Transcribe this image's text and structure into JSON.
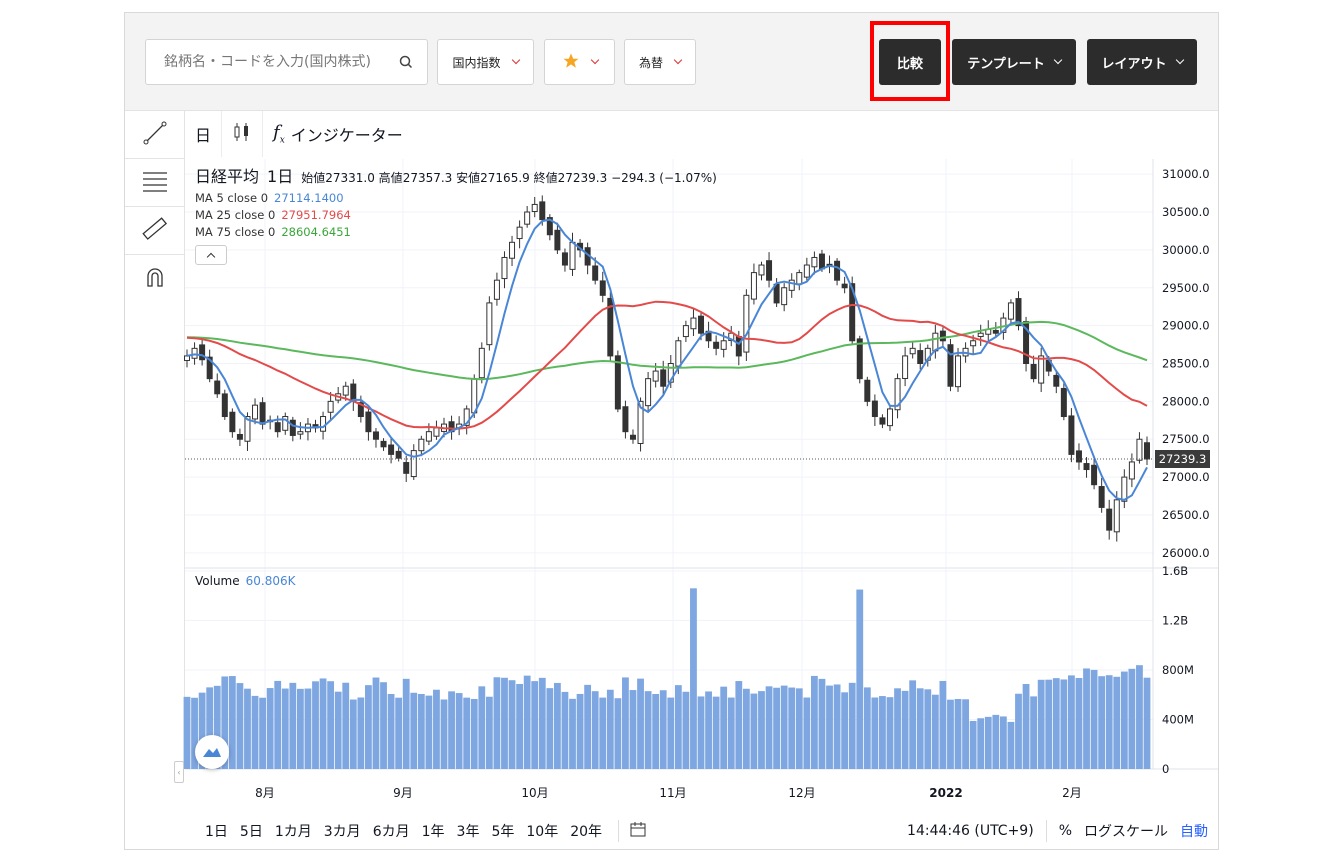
{
  "toolbar": {
    "search_placeholder": "銘柄名・コードを入力(国内株式)",
    "index_label": "国内指数",
    "fx_label": "為替",
    "compare_label": "比較",
    "template_label": "テンプレート",
    "layout_label": "レイアウト"
  },
  "chart_toolbar": {
    "interval": "日",
    "indicators": "インジケーター"
  },
  "legend": {
    "symbol": "日経平均",
    "timeframe": "1日",
    "open_label": "始値",
    "open": "27331.0",
    "high_label": "高値",
    "high": "27357.3",
    "low_label": "安値",
    "low": "27165.9",
    "close_label": "終値",
    "close": "27239.3",
    "change": "−294.3 (−1.07%)",
    "ma": [
      {
        "label": "MA 5 close 0",
        "value": "27114.1400",
        "color": "#4a86d6"
      },
      {
        "label": "MA 25 close 0",
        "value": "27951.7964",
        "color": "#e34a4a"
      },
      {
        "label": "MA 75 close 0",
        "value": "28604.6451",
        "color": "#3aa53a"
      }
    ],
    "volume_label": "Volume",
    "volume_value": "60.806K"
  },
  "price_axis": {
    "labels": [
      "31000.0",
      "30500.0",
      "30000.0",
      "29500.0",
      "29000.0",
      "28500.0",
      "28000.0",
      "27500.0",
      "27000.0",
      "26500.0",
      "26000.0"
    ],
    "last_price": "27239.3"
  },
  "volume_axis": {
    "labels": [
      "1.6B",
      "1.2B",
      "800M",
      "400M",
      "0"
    ]
  },
  "time_axis": {
    "labels": [
      "8月",
      "9月",
      "10月",
      "11月",
      "12月",
      "2022",
      "2月"
    ]
  },
  "bottom": {
    "ranges": [
      "1日",
      "5日",
      "1カ月",
      "3カ月",
      "6カ月",
      "1年",
      "3年",
      "5年",
      "10年",
      "20年"
    ],
    "clock": "14:44:46 (UTC+9)",
    "percent": "%",
    "log": "ログスケール",
    "auto": "自動"
  },
  "colors": {
    "ma5": "#4a86d6",
    "ma25": "#e34a4a",
    "ma75": "#5cb85c",
    "volume": "#7ea6e0",
    "highlight": "#ff0000",
    "candle_down": "#333333"
  },
  "chart_data": {
    "type": "candlestick",
    "price_range": [
      25800,
      31200
    ],
    "volume_range": [
      0,
      1600
    ],
    "volume_unit": "M",
    "closes": [
      28600,
      28700,
      28550,
      28300,
      28100,
      27800,
      27600,
      27500,
      27800,
      27950,
      27700,
      27750,
      27600,
      27800,
      27550,
      27600,
      27700,
      27650,
      27800,
      28000,
      28100,
      28200,
      28000,
      27800,
      27600,
      27500,
      27400,
      27300,
      27250,
      27050,
      27350,
      27500,
      27600,
      27650,
      27700,
      27600,
      27700,
      27900,
      28300,
      28700,
      29300,
      29600,
      29900,
      30100,
      30300,
      30500,
      30600,
      30400,
      30200,
      30000,
      29800,
      30100,
      30000,
      29800,
      29600,
      29400,
      28600,
      27900,
      27600,
      27500,
      28000,
      28300,
      28400,
      28200,
      28500,
      28800,
      29000,
      29100,
      28900,
      28800,
      28700,
      28800,
      28900,
      28600,
      29400,
      29700,
      29800,
      29600,
      29300,
      29500,
      29600,
      29700,
      29800,
      29900,
      29750,
      29800,
      29600,
      29500,
      28800,
      28300,
      28000,
      27800,
      27700,
      27900,
      28300,
      28600,
      28700,
      28500,
      28700,
      28900,
      28800,
      28200,
      28600,
      28700,
      28800,
      28900,
      28950,
      28900,
      29100,
      29300,
      29000,
      28500,
      28300,
      28600,
      28400,
      28200,
      27800,
      27300,
      27200,
      27100,
      26900,
      26600,
      26300,
      26700,
      27000,
      27200,
      27500,
      27239
    ]
  }
}
